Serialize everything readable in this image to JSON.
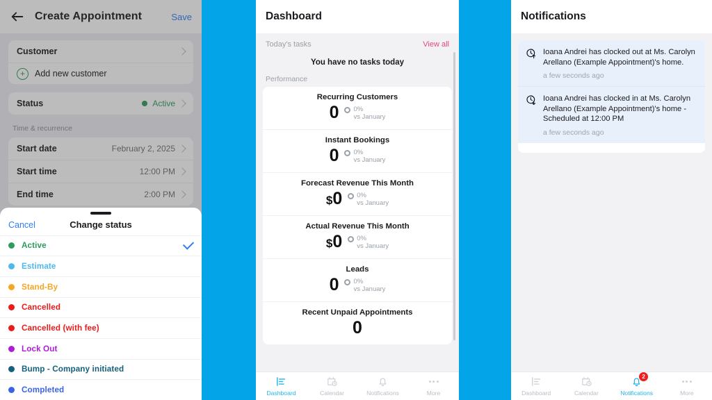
{
  "theme": {
    "backdrop_blue": "#03A5E8",
    "accent_blue": "#2f7df6",
    "tab_active": "#1fb6e8",
    "pink": "#e8447e",
    "badge_red": "#f01f1f"
  },
  "create_appointment": {
    "header": {
      "back_icon": "back-arrow-icon",
      "title": "Create Appointment",
      "save_label": "Save"
    },
    "customer_card": {
      "customer_label": "Customer",
      "add_new_label": "Add new customer",
      "add_icon": "plus-circle-icon"
    },
    "status_card": {
      "status_label": "Status",
      "status_value": "Active",
      "status_color": "#2e9b5c"
    },
    "time_section_label": "Time & recurrence",
    "time_rows": [
      {
        "label": "Start date",
        "value": "February 2, 2025"
      },
      {
        "label": "Start time",
        "value": "12:00 PM"
      },
      {
        "label": "End time",
        "value": "2:00 PM"
      }
    ]
  },
  "change_status_sheet": {
    "cancel_label": "Cancel",
    "title": "Change status",
    "options": [
      {
        "label": "Active",
        "color": "#2e9b5c",
        "selected": true
      },
      {
        "label": "Estimate",
        "color": "#4fb8ec",
        "selected": false
      },
      {
        "label": "Stand-By",
        "color": "#f5a623",
        "selected": false
      },
      {
        "label": "Cancelled",
        "color": "#e81c1c",
        "selected": false
      },
      {
        "label": "Cancelled (with fee)",
        "color": "#e81c1c",
        "selected": false
      },
      {
        "label": "Lock Out",
        "color": "#b01cd6",
        "selected": false
      },
      {
        "label": "Bump - Company initiated",
        "color": "#16617e",
        "selected": false
      },
      {
        "label": "Completed",
        "color": "#3b63e8",
        "selected": false
      }
    ]
  },
  "dashboard": {
    "title": "Dashboard",
    "tasks": {
      "section_label": "Today's tasks",
      "view_all_label": "View all",
      "empty_text": "You have no tasks today"
    },
    "performance_label": "Performance",
    "metrics": [
      {
        "name": "Recurring Customers",
        "value": "0",
        "currency": "",
        "delta": "0%",
        "delta_period": "vs January"
      },
      {
        "name": "Instant Bookings",
        "value": "0",
        "currency": "",
        "delta": "0%",
        "delta_period": "vs January"
      },
      {
        "name": "Forecast Revenue This Month",
        "value": "0",
        "currency": "$",
        "delta": "0%",
        "delta_period": "vs January"
      },
      {
        "name": "Actual Revenue This Month",
        "value": "0",
        "currency": "$",
        "delta": "0%",
        "delta_period": "vs January"
      },
      {
        "name": "Leads",
        "value": "0",
        "currency": "",
        "delta": "0%",
        "delta_period": "vs January"
      },
      {
        "name": "Recent Unpaid Appointments",
        "value": "0",
        "currency": "",
        "delta": "",
        "delta_period": ""
      }
    ],
    "tabbar": [
      {
        "label": "Dashboard",
        "icon": "dashboard-chart-icon",
        "active": true,
        "badge": ""
      },
      {
        "label": "Calendar",
        "icon": "calendar-clock-icon",
        "active": false,
        "badge": ""
      },
      {
        "label": "Notifications",
        "icon": "bell-icon",
        "active": false,
        "badge": ""
      },
      {
        "label": "More",
        "icon": "ellipsis-icon",
        "active": false,
        "badge": ""
      }
    ]
  },
  "notifications": {
    "title": "Notifications",
    "items": [
      {
        "icon": "clock-out-icon",
        "text": "Ioana Andrei has clocked out at Ms. Carolyn Arellano (Example Appointment)'s home.",
        "time": "a few seconds ago"
      },
      {
        "icon": "clock-in-icon",
        "text": "Ioana Andrei has clocked in at Ms. Carolyn Arellano (Example Appointment)'s home - Scheduled at 12:00 PM",
        "time": "a few seconds ago"
      }
    ],
    "tabbar": [
      {
        "label": "Dashboard",
        "icon": "dashboard-chart-icon",
        "active": false,
        "badge": ""
      },
      {
        "label": "Calendar",
        "icon": "calendar-clock-icon",
        "active": false,
        "badge": ""
      },
      {
        "label": "Notifications",
        "icon": "bell-icon",
        "active": true,
        "badge": "2"
      },
      {
        "label": "More",
        "icon": "ellipsis-icon",
        "active": false,
        "badge": ""
      }
    ]
  }
}
